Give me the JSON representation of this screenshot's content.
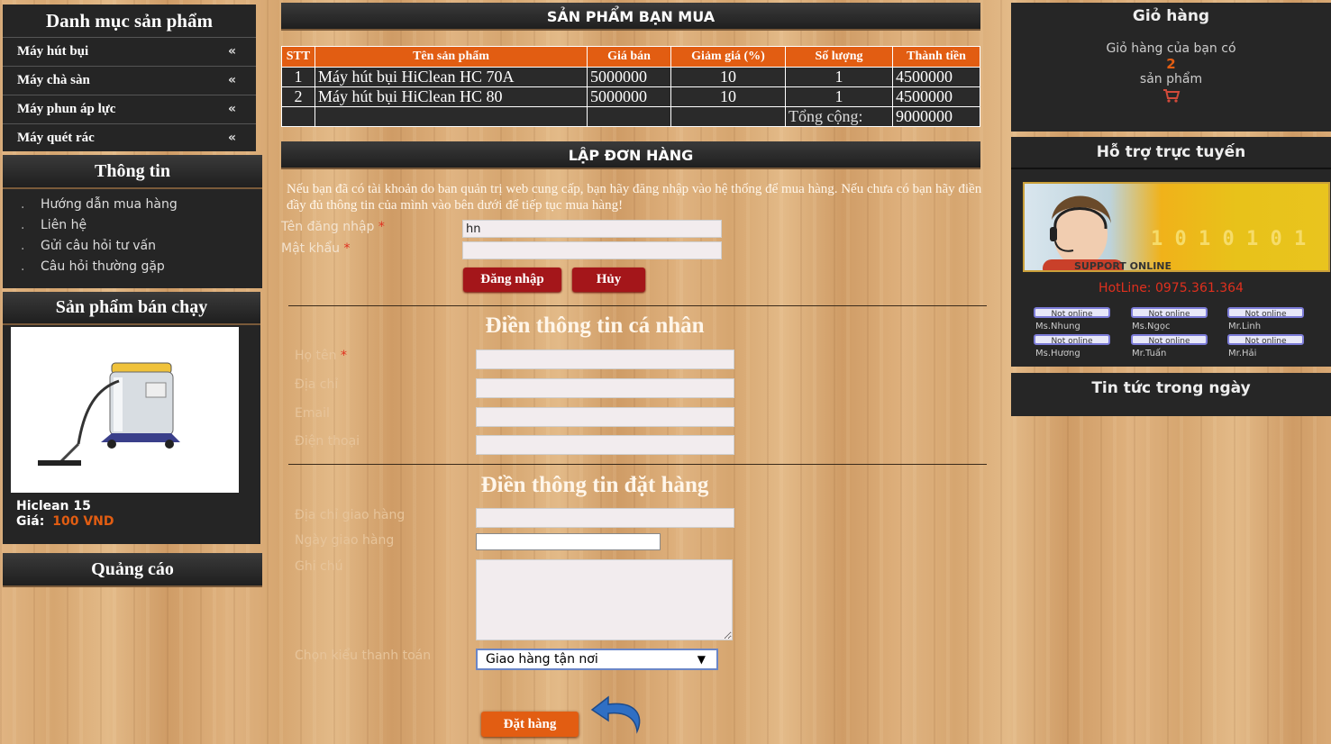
{
  "left": {
    "categories_title": "Danh mục sản phẩm",
    "categories": [
      {
        "label": "Máy hút bụi",
        "arrow": "«"
      },
      {
        "label": "Máy chà sàn",
        "arrow": "«"
      },
      {
        "label": "Máy phun áp lực",
        "arrow": "«"
      },
      {
        "label": "Máy quét rác",
        "arrow": "«"
      }
    ],
    "info_title": "Thông tin",
    "info_items": [
      "Hướng dẫn mua hàng",
      "Liên hệ",
      "Gửi câu hỏi tư vấn",
      "Câu hỏi thường gặp"
    ],
    "bestseller_title": "Sản phẩm bán chạy",
    "bestseller": {
      "name": "Hiclean 15",
      "price_label": "Giá:",
      "price": "100 VND"
    },
    "ads_title": "Quảng cáo"
  },
  "main": {
    "cart_title": "SẢN PHẨM BẠN MUA",
    "table": {
      "headers": [
        "STT",
        "Tên sản phẩm",
        "Giá bán",
        "Giảm giá (%)",
        "Số lượng",
        "Thành tiền"
      ],
      "rows": [
        [
          "1",
          "Máy hút bụi HiClean HC 70A",
          "5000000",
          "10",
          "1",
          "4500000"
        ],
        [
          "2",
          "Máy hút bụi HiClean HC 80",
          "5000000",
          "10",
          "1",
          "4500000"
        ]
      ],
      "total_label": "Tổng cộng:",
      "total_value": "9000000"
    },
    "order_title": "LẬP ĐƠN HÀNG",
    "notice": "Nếu bạn đã có tài khoản do ban quản trị web cung cấp, bạn hãy đăng nhập vào hệ thống để mua hàng. Nếu chưa có bạn hãy điền đầy đủ thông tin của mình vào bên dưới để tiếp tục mua hàng!",
    "login": {
      "username_label": "Tên đăng nhập",
      "username_value": "hn",
      "password_label": "Mật khẩu",
      "required_mark": "*",
      "login_button": "Đăng nhập",
      "cancel_button": "Hủy"
    },
    "personal_title": "Điền thông tin cá nhân",
    "personal_fields": {
      "fullname": "Họ tên",
      "address": "Địa chỉ",
      "email": "Email",
      "phone": "Điện thoại"
    },
    "order_info_title": "Điền thông tin đặt hàng",
    "order_fields": {
      "ship_address": "Địa chỉ giao hàng",
      "ship_date": "Ngày giao hàng",
      "note": "Ghi chú",
      "payment_label": "Chọn kiểu thanh toán",
      "payment_selected": "Giao hàng tận nơi"
    },
    "submit_button": "Đặt hàng"
  },
  "right": {
    "cart_title": "Giỏ hàng",
    "cart_text1": "Giỏ hàng của bạn có",
    "cart_count": "2",
    "cart_text2": "sản phẩm",
    "support_title": "Hỗ trợ trực tuyến",
    "support_banner_text": "SUPPORT ONLINE",
    "hotline": "HotLine: 0975.361.364",
    "support_staff": [
      {
        "name": "Ms.Nhung",
        "status": "Not online"
      },
      {
        "name": "Ms.Ngọc",
        "status": "Not online"
      },
      {
        "name": "Mr.Linh",
        "status": "Not online"
      },
      {
        "name": "Ms.Hương",
        "status": "Not online"
      },
      {
        "name": "Mr.Tuấn",
        "status": "Not online"
      },
      {
        "name": "Mr.Hải",
        "status": "Not online"
      }
    ],
    "news_title": "Tin tức trong ngày"
  },
  "colors": {
    "accent": "#e25d12",
    "button_red": "#a4161a",
    "hotline": "#e0301e"
  }
}
